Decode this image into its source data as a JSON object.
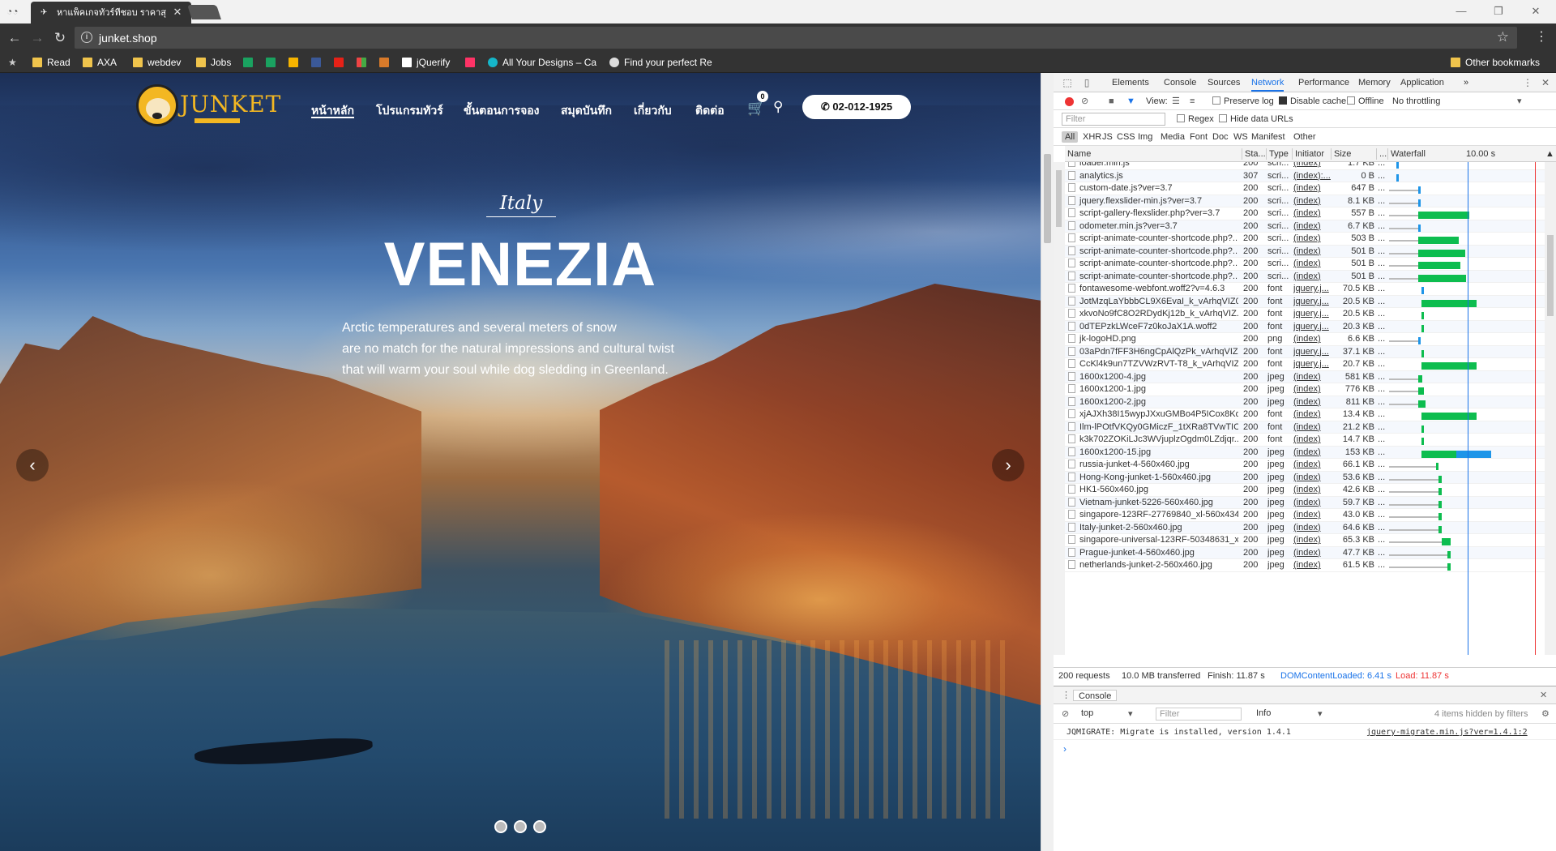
{
  "browser": {
    "tab_title": "หาแพ็คเกจทัวร์ที่ชอบ ราคาสุ",
    "url": "junket.shop",
    "bookmarks": [
      {
        "label": "Read"
      },
      {
        "label": "AXA"
      },
      {
        "label": "webdev"
      },
      {
        "label": "Jobs"
      },
      {
        "label": "jQuerify"
      },
      {
        "label": "All Your Designs – Ca"
      },
      {
        "label": "Find your perfect Re"
      }
    ],
    "other_bookmarks": "Other bookmarks"
  },
  "site": {
    "logo_text": "JUNKET",
    "nav": [
      "หน้าหลัก",
      "โปรแกรมทัวร์",
      "ขั้นตอนการจอง",
      "สมุดบันทึก",
      "เกี่ยวกับ",
      "ติดต่อ"
    ],
    "cart_count": "0",
    "phone": "02-012-1925",
    "hero": {
      "country": "Italy",
      "city": "VENEZIA",
      "description": [
        "Arctic temperatures and several meters of snow",
        "are no match for the natural impressions and cultural twist",
        "that will warm your soul while dog sledding in Greenland."
      ]
    }
  },
  "devtools": {
    "tabs": [
      "Elements",
      "Console",
      "Sources",
      "Network",
      "Performance",
      "Memory",
      "Application"
    ],
    "controls": {
      "view": "View:",
      "preserve_log": "Preserve log",
      "disable_cache": "Disable cache",
      "offline": "Offline",
      "throttling": "No throttling"
    },
    "filter_placeholder": "Filter",
    "regex": "Regex",
    "hide_data_urls": "Hide data URLs",
    "types": [
      "All",
      "XHR",
      "JS",
      "CSS",
      "Img",
      "Media",
      "Font",
      "Doc",
      "WS",
      "Manifest",
      "Other"
    ],
    "columns": {
      "name": "Name",
      "status": "Sta...",
      "type": "Type",
      "initiator": "Initiator",
      "size": "Size",
      "more": "...",
      "waterfall": "Waterfall",
      "time": "10.00 s"
    },
    "rows": [
      {
        "name": "loader.min.js",
        "status": "200",
        "type": "scri...",
        "initiator": "(index)",
        "size": "1.7 KB",
        "wf": [
          0.05,
          0.0,
          0.01,
          0.0
        ]
      },
      {
        "name": "analytics.js",
        "status": "307",
        "type": "scri...",
        "initiator": "(index):...",
        "size": "0 B",
        "wf": [
          0.05,
          0.0,
          0.0,
          0.01
        ]
      },
      {
        "name": "custom-date.js?ver=3.7",
        "status": "200",
        "type": "scri...",
        "initiator": "(index)",
        "size": "647 B",
        "wf": [
          0.0,
          0.2,
          0.01,
          0.0
        ]
      },
      {
        "name": "jquery.flexslider-min.js?ver=3.7",
        "status": "200",
        "type": "scri...",
        "initiator": "(index)",
        "size": "8.1 KB",
        "wf": [
          0.0,
          0.2,
          0.01,
          0.0
        ]
      },
      {
        "name": "script-gallery-flexslider.php?ver=3.7",
        "status": "200",
        "type": "scri...",
        "initiator": "(index)",
        "size": "557 B",
        "wf": [
          0.0,
          0.2,
          0.35,
          0.0
        ]
      },
      {
        "name": "odometer.min.js?ver=3.7",
        "status": "200",
        "type": "scri...",
        "initiator": "(index)",
        "size": "6.7 KB",
        "wf": [
          0.0,
          0.2,
          0.01,
          0.0
        ]
      },
      {
        "name": "script-animate-counter-shortcode.php?...",
        "status": "200",
        "type": "scri...",
        "initiator": "(index)",
        "size": "503 B",
        "wf": [
          0.0,
          0.2,
          0.28,
          0.0
        ]
      },
      {
        "name": "script-animate-counter-shortcode.php?...",
        "status": "200",
        "type": "scri...",
        "initiator": "(index)",
        "size": "501 B",
        "wf": [
          0.0,
          0.2,
          0.32,
          0.0
        ]
      },
      {
        "name": "script-animate-counter-shortcode.php?...",
        "status": "200",
        "type": "scri...",
        "initiator": "(index)",
        "size": "501 B",
        "wf": [
          0.0,
          0.2,
          0.29,
          0.0
        ]
      },
      {
        "name": "script-animate-counter-shortcode.php?...",
        "status": "200",
        "type": "scri...",
        "initiator": "(index)",
        "size": "501 B",
        "wf": [
          0.0,
          0.2,
          0.33,
          0.0
        ]
      },
      {
        "name": "fontawesome-webfont.woff2?v=4.6.3",
        "status": "200",
        "type": "font",
        "initiator": "jquery.j...",
        "size": "70.5 KB",
        "wf": [
          0.22,
          0.0,
          0.01,
          0.0
        ]
      },
      {
        "name": "JotMzqLaYbbbCL9X6EvaI_k_vArhqVIZ0...",
        "status": "200",
        "type": "font",
        "initiator": "jquery.j...",
        "size": "20.5 KB",
        "wf": [
          0.22,
          0.0,
          0.38,
          0.0
        ]
      },
      {
        "name": "xkvoNo9fC8O2RDydKj12b_k_vArhqVIZ...",
        "status": "200",
        "type": "font",
        "initiator": "jquery.j...",
        "size": "20.5 KB",
        "wf": [
          0.22,
          0.0,
          0.02,
          0.0
        ]
      },
      {
        "name": "0dTEPzkLWceF7z0koJaX1A.woff2",
        "status": "200",
        "type": "font",
        "initiator": "jquery.j...",
        "size": "20.3 KB",
        "wf": [
          0.22,
          0.0,
          0.02,
          0.0
        ]
      },
      {
        "name": "jk-logoHD.png",
        "status": "200",
        "type": "png",
        "initiator": "(index)",
        "size": "6.6 KB",
        "wf": [
          0.0,
          0.2,
          0.01,
          0.0
        ]
      },
      {
        "name": "03aPdn7fFF3H6ngCpAlQzPk_vArhqVIZ...",
        "status": "200",
        "type": "font",
        "initiator": "jquery.j...",
        "size": "37.1 KB",
        "wf": [
          0.22,
          0.0,
          0.02,
          0.0
        ]
      },
      {
        "name": "CcKl4k9un7TZVWzRVT-T8_k_vArhqVIZ...",
        "status": "200",
        "type": "font",
        "initiator": "jquery.j...",
        "size": "20.7 KB",
        "wf": [
          0.22,
          0.0,
          0.38,
          0.0
        ]
      },
      {
        "name": "1600x1200-4.jpg",
        "status": "200",
        "type": "jpeg",
        "initiator": "(index)",
        "size": "581 KB",
        "wf": [
          0.0,
          0.2,
          0.03,
          0.0
        ]
      },
      {
        "name": "1600x1200-1.jpg",
        "status": "200",
        "type": "jpeg",
        "initiator": "(index)",
        "size": "776 KB",
        "wf": [
          0.0,
          0.2,
          0.04,
          0.0
        ]
      },
      {
        "name": "1600x1200-2.jpg",
        "status": "200",
        "type": "jpeg",
        "initiator": "(index)",
        "size": "811 KB",
        "wf": [
          0.0,
          0.2,
          0.05,
          0.0
        ]
      },
      {
        "name": "xjAJXh38I15wypJXxuGMBo4P5ICox8Kq...",
        "status": "200",
        "type": "font",
        "initiator": "(index)",
        "size": "13.4 KB",
        "wf": [
          0.22,
          0.0,
          0.38,
          0.0
        ]
      },
      {
        "name": "Ilm-lPOtfVKQy0GMiczF_1tXRa8TVwTIC...",
        "status": "200",
        "type": "font",
        "initiator": "(index)",
        "size": "21.2 KB",
        "wf": [
          0.22,
          0.0,
          0.02,
          0.0
        ]
      },
      {
        "name": "k3k702ZOKiLJc3WVjuplzOgdm0LZdjqr...",
        "status": "200",
        "type": "font",
        "initiator": "(index)",
        "size": "14.7 KB",
        "wf": [
          0.22,
          0.0,
          0.02,
          0.0
        ]
      },
      {
        "name": "1600x1200-15.jpg",
        "status": "200",
        "type": "jpeg",
        "initiator": "(index)",
        "size": "153 KB",
        "wf": [
          0.22,
          0.0,
          0.24,
          0.24
        ]
      },
      {
        "name": "russia-junket-4-560x460.jpg",
        "status": "200",
        "type": "jpeg",
        "initiator": "(index)",
        "size": "66.1 KB",
        "wf": [
          0.0,
          0.32,
          0.02,
          0.0
        ]
      },
      {
        "name": "Hong-Kong-junket-1-560x460.jpg",
        "status": "200",
        "type": "jpeg",
        "initiator": "(index)",
        "size": "53.6 KB",
        "wf": [
          0.0,
          0.34,
          0.02,
          0.0
        ]
      },
      {
        "name": "HK1-560x460.jpg",
        "status": "200",
        "type": "jpeg",
        "initiator": "(index)",
        "size": "42.6 KB",
        "wf": [
          0.0,
          0.34,
          0.02,
          0.0
        ]
      },
      {
        "name": "Vietnam-junket-5226-560x460.jpg",
        "status": "200",
        "type": "jpeg",
        "initiator": "(index)",
        "size": "59.7 KB",
        "wf": [
          0.0,
          0.34,
          0.02,
          0.0
        ]
      },
      {
        "name": "singapore-123RF-27769840_xl-560x434...",
        "status": "200",
        "type": "jpeg",
        "initiator": "(index)",
        "size": "43.0 KB",
        "wf": [
          0.0,
          0.34,
          0.02,
          0.0
        ]
      },
      {
        "name": "Italy-junket-2-560x460.jpg",
        "status": "200",
        "type": "jpeg",
        "initiator": "(index)",
        "size": "64.6 KB",
        "wf": [
          0.0,
          0.34,
          0.02,
          0.0
        ]
      },
      {
        "name": "singapore-universal-123RF-50348631_x...",
        "status": "200",
        "type": "jpeg",
        "initiator": "(index)",
        "size": "65.3 KB",
        "wf": [
          0.0,
          0.36,
          0.06,
          0.0
        ]
      },
      {
        "name": "Prague-junket-4-560x460.jpg",
        "status": "200",
        "type": "jpeg",
        "initiator": "(index)",
        "size": "47.7 KB",
        "wf": [
          0.0,
          0.4,
          0.02,
          0.0
        ]
      },
      {
        "name": "netherlands-junket-2-560x460.jpg",
        "status": "200",
        "type": "jpeg",
        "initiator": "(index)",
        "size": "61.5 KB",
        "wf": [
          0.0,
          0.4,
          0.02,
          0.0
        ]
      }
    ],
    "summary": {
      "requests": "200 requests",
      "transferred": "10.0 MB transferred",
      "finish": "Finish: 11.87 s",
      "dcl": "DOMContentLoaded: 6.41 s",
      "load": "Load: 11.87 s"
    },
    "console": {
      "tab": "Console",
      "context": "top",
      "filter_placeholder": "Filter",
      "level": "Info",
      "hidden": "4 items hidden by filters",
      "message": "JQMIGRATE: Migrate is installed, version 1.4.1",
      "source": "jquery-migrate.min.js?ver=1.4.1:2"
    }
  },
  "colors": {
    "accent": "#1a73e8",
    "recording": "#ee3333",
    "waterfall_green": "#0dbd4f",
    "waterfall_blue": "#1e95e8",
    "dcl": "#1a73e8",
    "load": "#e33"
  }
}
